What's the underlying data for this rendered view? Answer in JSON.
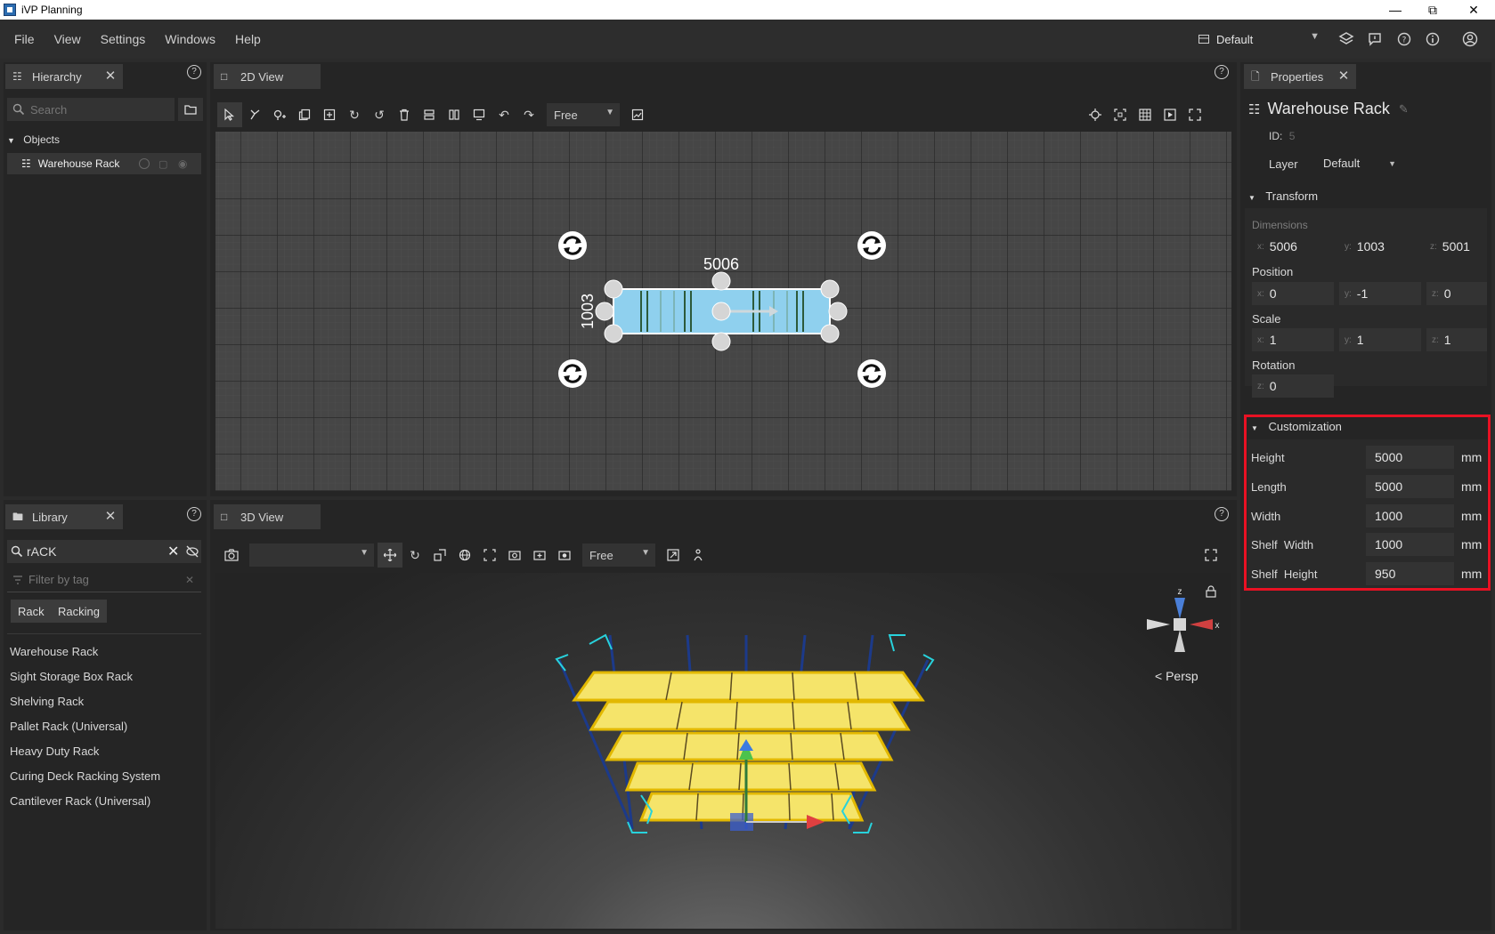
{
  "window": {
    "title": "iVP Planning"
  },
  "menu": [
    "File",
    "View",
    "Settings",
    "Windows",
    "Help"
  ],
  "layout_select": {
    "value": "Default"
  },
  "hierarchy": {
    "tab_label": "Hierarchy",
    "search_placeholder": "Search",
    "group_label": "Objects",
    "items": [
      {
        "label": "Warehouse Rack"
      }
    ]
  },
  "view2d": {
    "tab_label": "2D View",
    "mode_select": "Free",
    "dim_length": "5006",
    "dim_width": "1003"
  },
  "library": {
    "tab_label": "Library",
    "search_value": "rACK",
    "tag_filter_placeholder": "Filter by tag",
    "tags": [
      "Rack",
      "Racking"
    ],
    "items": [
      "Warehouse Rack",
      "Sight Storage Box Rack",
      "Shelving Rack",
      "Pallet Rack (Universal)",
      "Heavy Duty Rack",
      "Curing Deck Racking System",
      "Cantilever Rack (Universal)"
    ]
  },
  "view3d": {
    "tab_label": "3D View",
    "camera_select": "",
    "mode_select": "Free",
    "projection": "< Persp",
    "gizmo_x": "x",
    "gizmo_z": "z"
  },
  "properties": {
    "tab_label": "Properties",
    "object_name": "Warehouse Rack",
    "id_label": "ID:",
    "id_value": "5",
    "layer_label": "Layer",
    "layer_value": "Default",
    "transform_header": "Transform",
    "dimensions": {
      "label": "Dimensions",
      "x": "5006",
      "y": "1003",
      "z": "5001"
    },
    "position": {
      "label": "Position",
      "x": "0",
      "y": "-1",
      "z": "0"
    },
    "scale": {
      "label": "Scale",
      "x": "1",
      "y": "1",
      "z": "1"
    },
    "rotation": {
      "label": "Rotation",
      "z": "0"
    },
    "customization": {
      "header": "Customization",
      "rows": [
        {
          "label": "Height",
          "value": "5000",
          "unit": "mm"
        },
        {
          "label": "Length",
          "value": "5000",
          "unit": "mm"
        },
        {
          "label": "Width",
          "value": "1000",
          "unit": "mm"
        },
        {
          "label": "Shelf  Width",
          "value": "1000",
          "unit": "mm"
        },
        {
          "label": "Shelf  Height",
          "value": "950",
          "unit": "mm"
        }
      ]
    }
  },
  "colors": {
    "accent_red": "#e81123",
    "rack_selection": "#8fd0ee",
    "rack_shelf": "#f5e46a",
    "gizmo_x": "#e04040",
    "gizmo_y": "#4cc24c",
    "gizmo_z": "#3b7be0"
  }
}
